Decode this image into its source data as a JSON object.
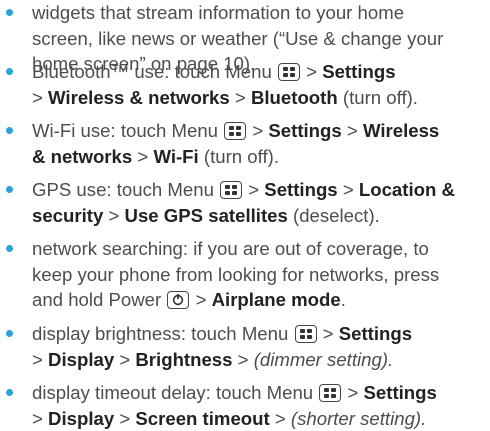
{
  "items": [
    {
      "lines": [
        "widgets that stream information to your home",
        "screen, like news or weather (“Use & change your",
        "home screen” on page 10)."
      ]
    },
    {
      "parts": {
        "a": "Bluetooth™ use: touch Menu",
        "b": ">",
        "c": "Settings",
        "d": ">",
        "e": "Wireless & networks",
        "f": ">",
        "g": "Bluetooth",
        "h": "(turn off)."
      }
    },
    {
      "parts": {
        "a": "Wi-Fi use: touch Menu",
        "b": ">",
        "c": "Settings",
        "d": ">",
        "e1": "Wireless",
        "e2": "& networks",
        "f": ">",
        "g": "Wi-Fi",
        "h": "(turn off)."
      }
    },
    {
      "parts": {
        "a": "GPS use: touch Menu",
        "b": ">",
        "c": "Settings",
        "d": ">",
        "e1": "Location &",
        "e2": "security",
        "f": ">",
        "g": "Use GPS satellites",
        "h": "(deselect)."
      }
    },
    {
      "parts": {
        "l1": "network searching: if you are out of coverage, to",
        "l2": "keep your phone from looking for networks, press",
        "l3a": "and hold Power",
        "b": ">",
        "c": "Airplane mode",
        "d": "."
      }
    },
    {
      "parts": {
        "a": "display brightness: touch Menu",
        "b": ">",
        "c": "Settings",
        "d": ">",
        "e": "Display",
        "f": ">",
        "g": "Brightness",
        "h": ">",
        "i": "(dimmer setting)."
      }
    },
    {
      "parts": {
        "a": "display timeout delay: touch Menu",
        "b": ">",
        "c": "Settings",
        "d": ">",
        "e": "Display",
        "f": ">",
        "g": "Screen timeout",
        "h": ">",
        "i": "(shorter setting)."
      }
    }
  ],
  "colors": {
    "bullet": "#2aa3d8",
    "text": "#4d4d4d",
    "bold": "#222222"
  },
  "icons": {
    "menu": "menu-key-icon",
    "power": "power-key-icon"
  }
}
